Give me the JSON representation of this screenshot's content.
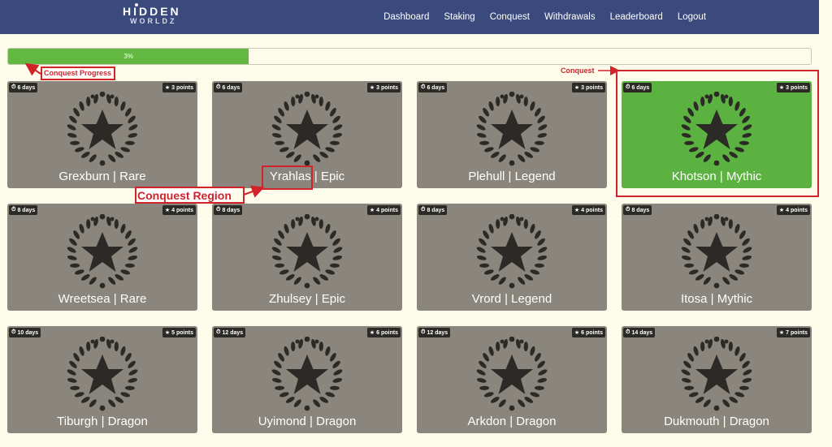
{
  "brand": {
    "logo_top": "HIDDEN",
    "logo_bottom": "WORLDZ"
  },
  "nav": {
    "items": [
      "Dashboard",
      "Staking",
      "Conquest",
      "Withdrawals",
      "Leaderboard",
      "Logout"
    ]
  },
  "progress": {
    "value": 0.03,
    "label": "3%"
  },
  "cards": [
    {
      "days": "6 days",
      "points": "3 points",
      "title": "Grexburn | Rare",
      "highlight": false
    },
    {
      "days": "6 days",
      "points": "3 points",
      "title": "Yrahlas | Epic",
      "highlight": false
    },
    {
      "days": "6 days",
      "points": "3 points",
      "title": "Plehull | Legend",
      "highlight": false
    },
    {
      "days": "6 days",
      "points": "3 points",
      "title": "Khotson | Mythic",
      "highlight": true
    },
    {
      "days": "8 days",
      "points": "4 points",
      "title": "Wreetsea | Rare",
      "highlight": false
    },
    {
      "days": "8 days",
      "points": "4 points",
      "title": "Zhulsey | Epic",
      "highlight": false
    },
    {
      "days": "8 days",
      "points": "4 points",
      "title": "Vrord | Legend",
      "highlight": false
    },
    {
      "days": "8 days",
      "points": "4 points",
      "title": "Itosa | Mythic",
      "highlight": false
    },
    {
      "days": "10 days",
      "points": "5 points",
      "title": "Tiburgh | Dragon",
      "highlight": false
    },
    {
      "days": "12 days",
      "points": "6 points",
      "title": "Uyimond | Dragon",
      "highlight": false
    },
    {
      "days": "12 days",
      "points": "6 points",
      "title": "Arkdon | Dragon",
      "highlight": false
    },
    {
      "days": "14 days",
      "points": "7 points",
      "title": "Dukmouth | Dragon",
      "highlight": false
    }
  ],
  "annotations": {
    "progress_label": "Conquest Progress",
    "conquest_label": "Conquest",
    "region_label": "Conquest Region"
  },
  "icons": {
    "clock": "clock-icon",
    "star": "star-icon",
    "emblem": "laurel-star-emblem-icon"
  },
  "colors": {
    "navbar": "#3b4a7c",
    "page_bg": "#fdfbe9",
    "card_bg": "#8a857d",
    "card_highlight": "#5cb241",
    "progress_fill": "#62b840",
    "annotation": "#d1232a"
  }
}
